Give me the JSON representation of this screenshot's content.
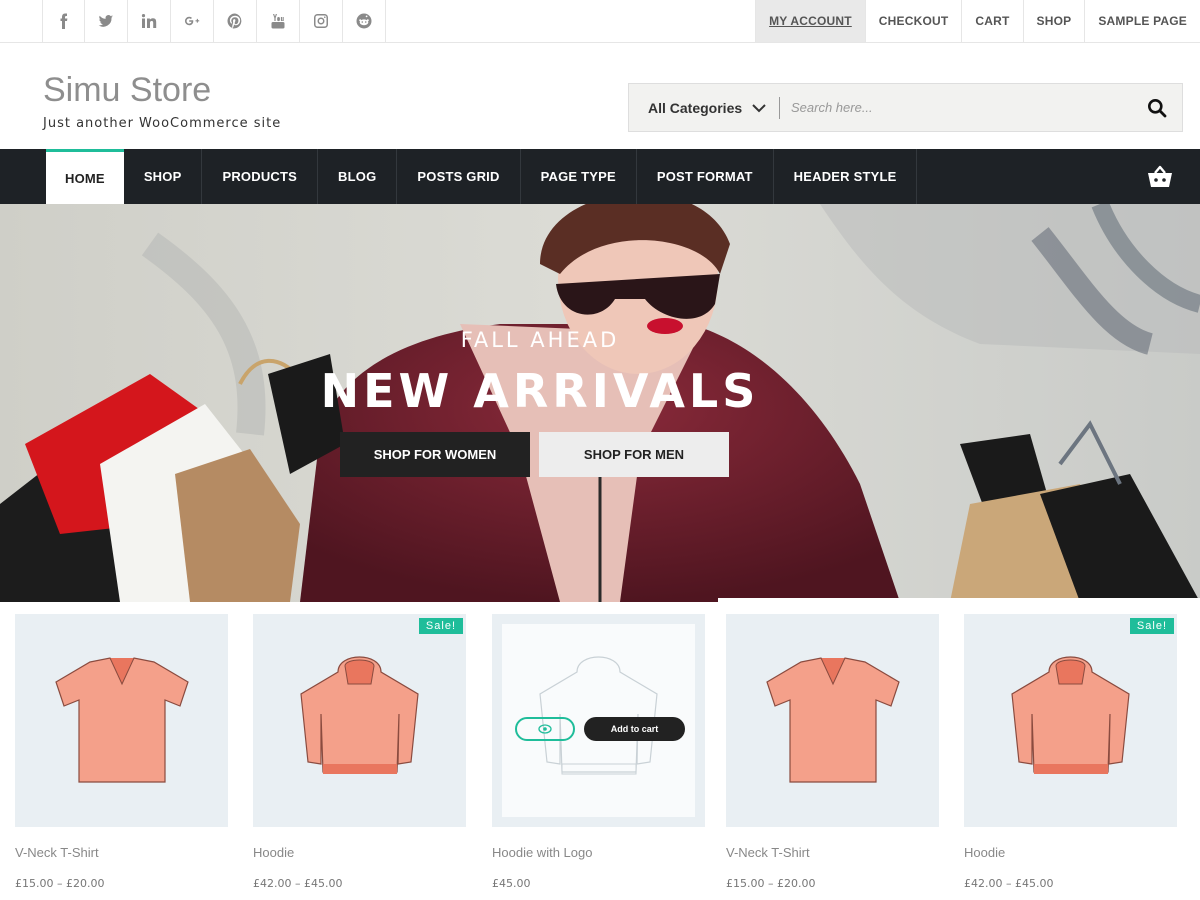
{
  "social": [
    "facebook-icon",
    "twitter-icon",
    "linkedin-icon",
    "google-plus-icon",
    "pinterest-icon",
    "youtube-icon",
    "instagram-icon",
    "reddit-icon"
  ],
  "top_links": [
    "My Account",
    "Checkout",
    "Cart",
    "Shop",
    "Sample Page"
  ],
  "brand": {
    "title": "Simu Store",
    "tagline": "Just another WooCommerce site"
  },
  "search": {
    "category": "All Categories",
    "placeholder": "Search here..."
  },
  "nav": [
    "Home",
    "Shop",
    "Products",
    "Blog",
    "Posts Grid",
    "Page Type",
    "Post Format",
    "Header Style"
  ],
  "hero": {
    "subtitle": "FALL AHEAD",
    "title": "NEW ARRIVALS",
    "btn_women": "SHOP FOR WOMEN",
    "btn_men": "SHOP FOR MEN"
  },
  "products": [
    {
      "name": "V-Neck T-Shirt",
      "price": "£15.00 – £20.00",
      "sale": ""
    },
    {
      "name": "Hoodie",
      "price": "£42.00 – £45.00",
      "sale": "Sale!"
    },
    {
      "name": "Hoodie with Logo",
      "price": "£45.00",
      "sale": "",
      "add_to_cart": "Add to cart"
    },
    {
      "name": "V-Neck T-Shirt",
      "price": "£15.00 – £20.00",
      "sale": ""
    },
    {
      "name": "Hoodie",
      "price": "£42.00 – £45.00",
      "sale": "Sale!"
    }
  ],
  "colors": {
    "accent": "#1fbd9a",
    "nav_bg": "#1e2226",
    "product_bg": "#e9eff3",
    "garment": "#f4a08a"
  }
}
